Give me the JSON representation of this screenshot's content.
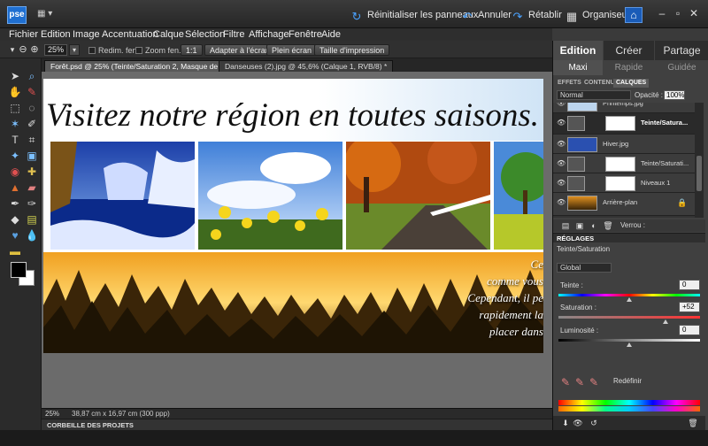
{
  "app": {
    "logo": "pse"
  },
  "topbar": {
    "reset_panels": "Réinitialiser les panneaux",
    "undo": "Annuler",
    "redo": "Rétablir",
    "organizer": "Organiseur"
  },
  "menu": {
    "items": [
      "Fichier",
      "Edition",
      "Image",
      "Accentuation",
      "Calque",
      "Sélection",
      "Filtre",
      "Affichage",
      "Fenêtre",
      "Aide"
    ]
  },
  "options": {
    "zoom": "25%",
    "resize_windows": "Redim. fen.",
    "zoom_all": "Zoom fen.",
    "one_to_one": "1:1",
    "fit_screen": "Adapter à l'écran",
    "full_screen": "Plein écran",
    "print_size": "Taille d'impression"
  },
  "tabs": [
    {
      "label": "Forêt.psd @ 25% (Teinte/Saturation 2, Masque de fusion/8) *",
      "active": true
    },
    {
      "label": "Danseuses (2).jpg @ 45,6% (Calque 1, RVB/8) *",
      "active": false
    }
  ],
  "document": {
    "title": "Visitez notre région en toutes saisons.",
    "forest_text": [
      "Ce",
      "comme vous",
      "Cependant, il pe",
      "rapidement la",
      "placer dans"
    ]
  },
  "status": {
    "zoom": "25%",
    "dimensions": "38,87 cm x 16,97 cm (300 ppp)",
    "project_bin": "CORBEILLE DES PROJETS"
  },
  "panel": {
    "modes": [
      "Edition",
      "Créer",
      "Partage"
    ],
    "submodes": [
      "Maxi",
      "Rapide",
      "Guidée"
    ],
    "tabs": [
      "EFFETS",
      "CONTENU",
      "CALQUES"
    ],
    "blend_mode": "Normal",
    "opacity_label": "Opacité :",
    "opacity_value": "100%",
    "layers": [
      {
        "name": "Printemps.jpg",
        "selected": false,
        "mask": false
      },
      {
        "name": "Teinte/Satura...",
        "selected": true,
        "mask": true
      },
      {
        "name": "Hiver.jpg",
        "selected": false,
        "mask": false
      },
      {
        "name": "Teinte/Saturati...",
        "selected": false,
        "mask": true
      },
      {
        "name": "Niveaux 1",
        "selected": false,
        "mask": true
      },
      {
        "name": "Arrière-plan",
        "selected": false,
        "mask": false
      }
    ],
    "lock_label": "Verrou :",
    "adjustments_header": "RÉGLAGES",
    "adjustment_name": "Teinte/Saturation",
    "range": "Global",
    "hue_label": "Teinte :",
    "hue_value": "0",
    "saturation_label": "Saturation :",
    "saturation_value": "+52",
    "lightness_label": "Luminosité :",
    "lightness_value": "0",
    "reset_label": "Redéfinir"
  }
}
